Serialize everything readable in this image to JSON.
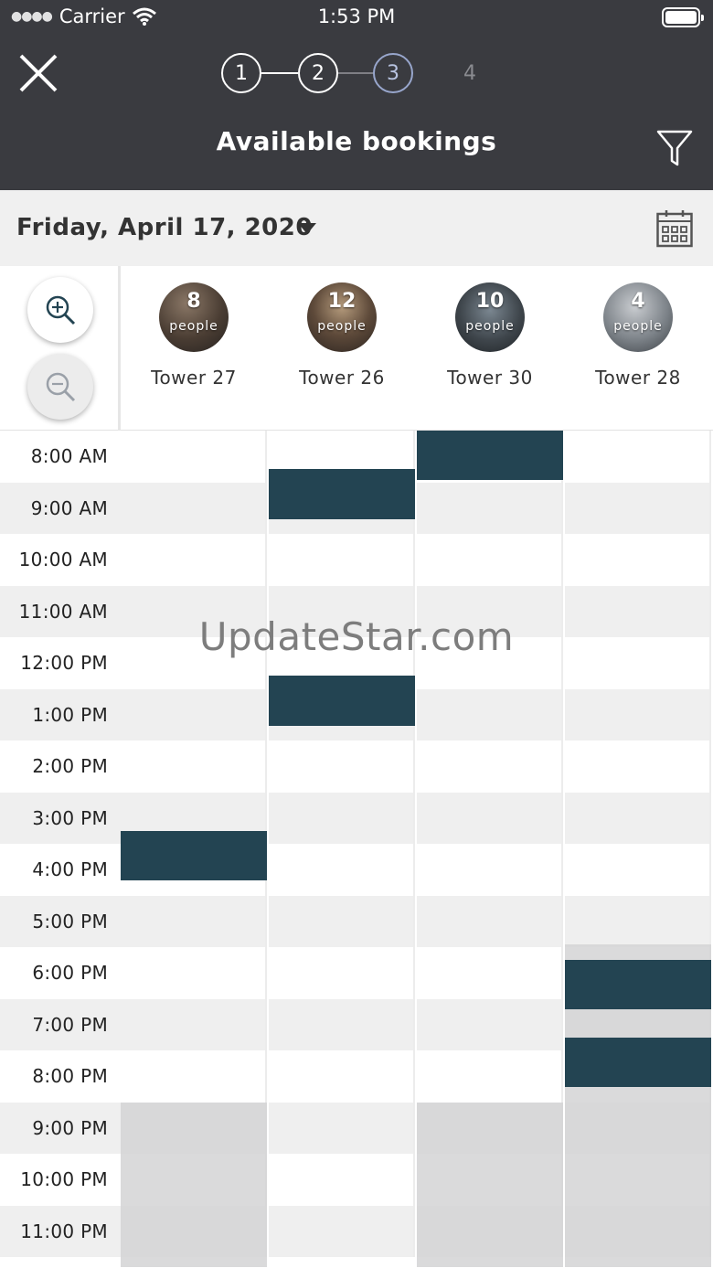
{
  "status_bar": {
    "carrier": "Carrier",
    "time": "1:53 PM"
  },
  "header": {
    "title": "Available bookings",
    "steps": [
      "1",
      "2",
      "3",
      "4"
    ],
    "current_step": 3
  },
  "date_bar": {
    "date": "Friday, April 17, 2020"
  },
  "rooms": [
    {
      "name": "Tower 27",
      "capacity": "8",
      "capacity_label": "people"
    },
    {
      "name": "Tower 26",
      "capacity": "12",
      "capacity_label": "people"
    },
    {
      "name": "Tower 30",
      "capacity": "10",
      "capacity_label": "people"
    },
    {
      "name": "Tower 28",
      "capacity": "4",
      "capacity_label": "people"
    }
  ],
  "times": [
    "8:00 AM",
    "9:00 AM",
    "10:00 AM",
    "11:00 AM",
    "12:00 PM",
    "1:00 PM",
    "2:00 PM",
    "3:00 PM",
    "4:00 PM",
    "5:00 PM",
    "6:00 PM",
    "7:00 PM",
    "8:00 PM",
    "9:00 PM",
    "10:00 PM",
    "11:00 PM"
  ],
  "bookings": [
    {
      "room": 0,
      "start": 7.75,
      "end": 8.71
    },
    {
      "room": 1,
      "start": 0.75,
      "end": 1.71
    },
    {
      "room": 1,
      "start": 4.75,
      "end": 5.71
    },
    {
      "room": 2,
      "start": 0.0,
      "end": 0.96
    },
    {
      "room": 3,
      "start": 10.25,
      "end": 11.21
    },
    {
      "room": 3,
      "start": 11.75,
      "end": 12.71
    }
  ],
  "unavailable": [
    {
      "room": 0,
      "start": 13,
      "end": 16.2
    },
    {
      "room": 2,
      "start": 13,
      "end": 16.2
    },
    {
      "room": 3,
      "start": 9.95,
      "end": 16.2
    }
  ],
  "watermark": "UpdateStar.com",
  "colors": {
    "header_bg": "#3a3b40",
    "booked": "#234452",
    "unavailable": "#d3d3d5",
    "row_alt": "#efefef"
  }
}
